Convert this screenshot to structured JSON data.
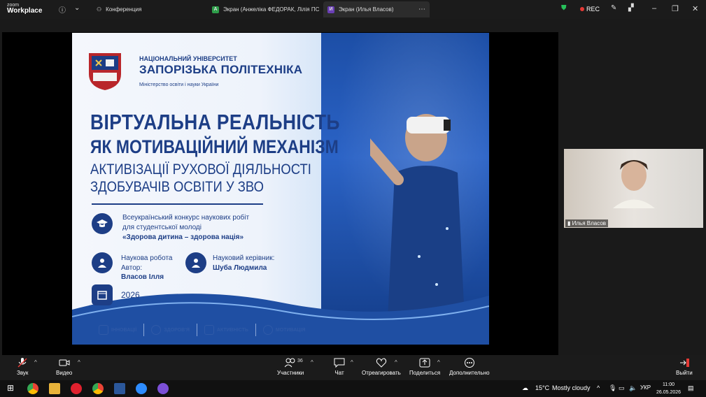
{
  "app": {
    "logo_line1": "zoom",
    "logo_line2": "Workplace"
  },
  "tabs": [
    {
      "label": "Конференция",
      "icon": "people-icon"
    },
    {
      "label": "Экран (Анжеліка ФЕДОРАК, Лілія ПС",
      "badge": "А",
      "badge_color": "#2e9e4a"
    },
    {
      "label": "Экран (Илья Власов)",
      "badge": "И",
      "badge_color": "#6a3fb5"
    }
  ],
  "rec_label": "REC",
  "slide": {
    "uni_line1": "НАЦІОНАЛЬНИЙ УНІВЕРСИТЕТ",
    "uni_line2": "ЗАПОРІЗЬКА ПОЛІТЕХНІКА",
    "uni_line3": "Міністерство освіти і науки України",
    "title1": "ВІРТУАЛЬНА РЕАЛЬНІСТЬ",
    "title2": "ЯК МОТИВАЦІЙНИЙ МЕХАНІЗМ",
    "title3": "АКТИВІЗАЦІЇ РУХОВОЇ ДІЯЛЬНОСТІ",
    "title4": "ЗДОБУВАЧІВ ОСВІТИ У ЗВО",
    "contest_line1": "Всеукраїнський конкурс наукових робіт",
    "contest_line2": "для студентської молоді",
    "contest_line3": "«Здорова дитина – здорова нація»",
    "work_label": "Наукова робота",
    "author_label": "Автор:",
    "author_name": "Власов Ілля",
    "supervisor_label": "Науковий керівник:",
    "supervisor_name": "Шуба Людмила",
    "year": "2026",
    "footer": [
      "ІННОВАЦІЇ",
      "ЗДОРОВ'Я",
      "АКТИВНІСТЬ",
      "МОТИВАЦІЯ"
    ]
  },
  "participant": {
    "name": "Илья Власов"
  },
  "toolbar": {
    "audio": "Звук",
    "video": "Видео",
    "participants": "Участники",
    "participants_count": "36",
    "chat": "Чат",
    "react": "Отреагировать",
    "share": "Поделиться",
    "more": "Дополнительно",
    "leave": "Выйти"
  },
  "taskbar": {
    "temp": "15°C",
    "weather": "Mostly cloudy",
    "lang": "УКР",
    "time": "11:00",
    "date": "26.05.2026"
  }
}
